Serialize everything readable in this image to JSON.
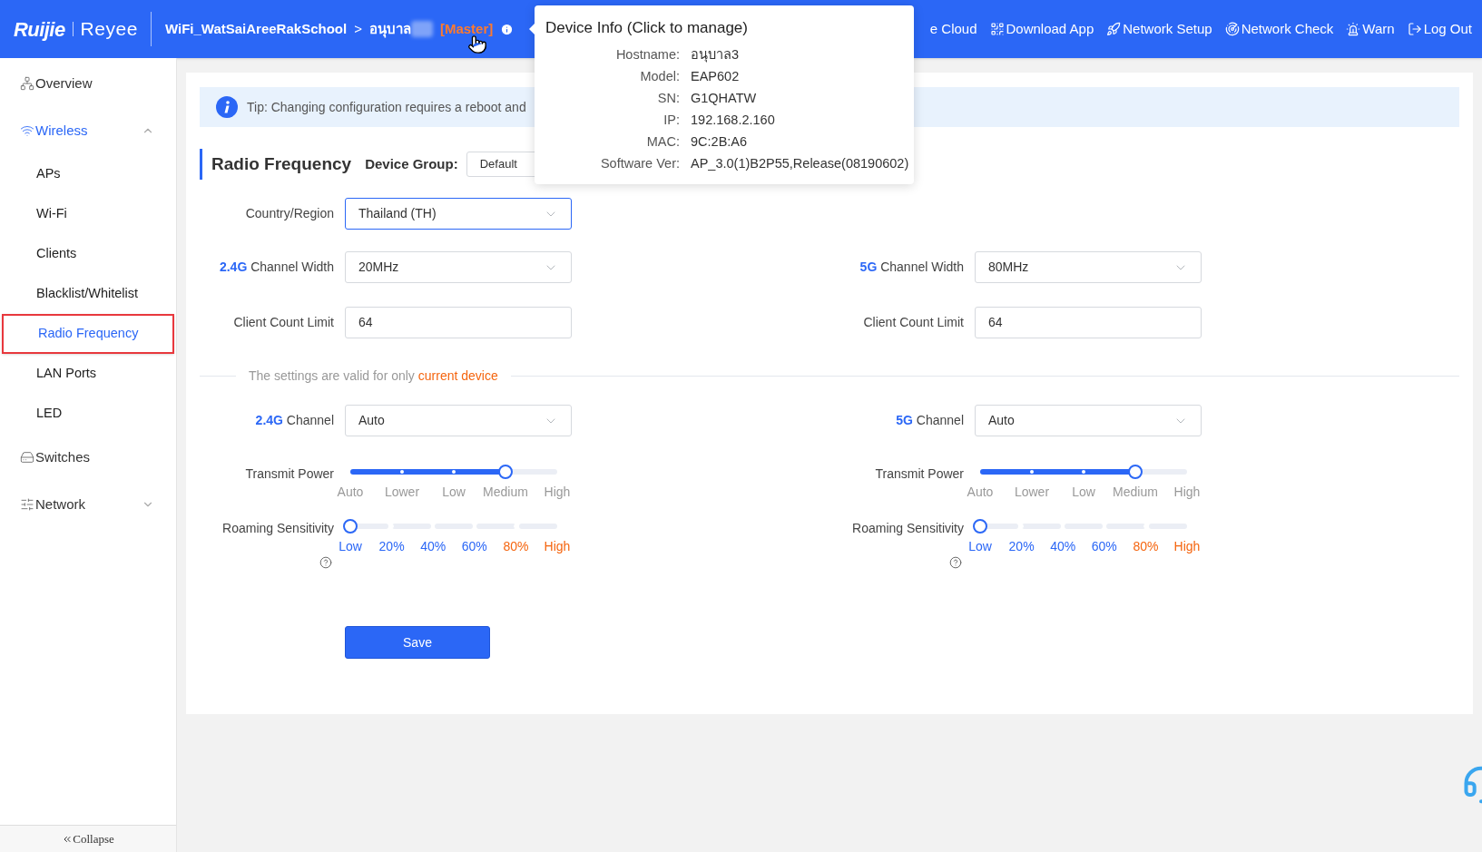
{
  "header": {
    "logo": {
      "brand": "Ruijie",
      "product": "Reyee"
    },
    "breadcrumb": {
      "network": "WiFi_WatSaiAreeRakSchool",
      "separator": ">",
      "device": "อนุบาล",
      "role": "[Master]"
    },
    "nav": [
      {
        "label": "e Cloud"
      },
      {
        "label": "Download App"
      },
      {
        "label": "Network Setup"
      },
      {
        "label": "Network Check"
      },
      {
        "label": "Warn"
      },
      {
        "label": "Log Out"
      }
    ]
  },
  "device_popover": {
    "title": "Device Info (Click to manage)",
    "rows": [
      {
        "label": "Hostname:",
        "value": "อนุบาล3"
      },
      {
        "label": "Model:",
        "value": "EAP602"
      },
      {
        "label": "SN:",
        "value": "G1QHATW"
      },
      {
        "label": "IP:",
        "value": "192.168.2.160"
      },
      {
        "label": "MAC:",
        "value": "9C:2B:A6"
      },
      {
        "label": "Software Ver:",
        "value": "AP_3.0(1)B2P55,Release(08190602)"
      }
    ]
  },
  "sidebar": {
    "items": [
      {
        "label": "Overview",
        "selected": false
      },
      {
        "label": "Wireless",
        "selected": true,
        "expanded": true,
        "children": [
          {
            "label": "APs",
            "selected": false
          },
          {
            "label": "Wi-Fi",
            "selected": false
          },
          {
            "label": "Clients",
            "selected": false
          },
          {
            "label": "Blacklist/Whitelist",
            "selected": false
          },
          {
            "label": "Radio Frequency",
            "selected": true
          },
          {
            "label": "LAN Ports",
            "selected": false
          },
          {
            "label": "LED",
            "selected": false
          }
        ]
      },
      {
        "label": "Switches",
        "selected": false
      },
      {
        "label": "Network",
        "selected": false,
        "expanded": false
      }
    ],
    "collapse": "Collapse"
  },
  "tip": "Tip: Changing configuration requires a reboot and",
  "section": {
    "title": "Radio Frequency",
    "device_group": {
      "label": "Device Group:",
      "value": "Default"
    }
  },
  "country": {
    "label": "Country/Region",
    "value": "Thailand (TH)",
    "focused": true
  },
  "settings_note": {
    "text": "The settings are valid for only ",
    "highlight": "current device"
  },
  "bands": [
    {
      "channel_width": {
        "band": "2.4G",
        "label": "Channel Width",
        "value": "20MHz"
      },
      "client_limit": {
        "label": "Client Count Limit",
        "value": "64"
      },
      "channel": {
        "band": "2.4G",
        "label": "Channel",
        "value": "Auto"
      },
      "transmit_power": {
        "label": "Transmit Power",
        "level": 0.75,
        "ticks": [
          "Auto",
          "Lower",
          "Low",
          "Medium",
          "High"
        ]
      },
      "roaming": {
        "label": "Roaming Sensitivity",
        "level": 0,
        "ticks": [
          {
            "label": "Low",
            "color": "#2b67f6"
          },
          {
            "label": "20%",
            "color": "#2b67f6"
          },
          {
            "label": "40%",
            "color": "#2b67f6"
          },
          {
            "label": "60%",
            "color": "#2b67f6"
          },
          {
            "label": "80%",
            "color": "#f5650f"
          },
          {
            "label": "High",
            "color": "#f5650f"
          }
        ]
      }
    },
    {
      "channel_width": {
        "band": "5G",
        "label": "Channel Width",
        "value": "80MHz"
      },
      "client_limit": {
        "label": "Client Count Limit",
        "value": "64"
      },
      "channel": {
        "band": "5G",
        "label": "Channel",
        "value": "Auto"
      },
      "transmit_power": {
        "label": "Transmit Power",
        "level": 0.75,
        "ticks": [
          "Auto",
          "Lower",
          "Low",
          "Medium",
          "High"
        ]
      },
      "roaming": {
        "label": "Roaming Sensitivity",
        "level": 0,
        "ticks": [
          {
            "label": "Low",
            "color": "#2b67f6"
          },
          {
            "label": "20%",
            "color": "#2b67f6"
          },
          {
            "label": "40%",
            "color": "#2b67f6"
          },
          {
            "label": "60%",
            "color": "#2b67f6"
          },
          {
            "label": "80%",
            "color": "#f5650f"
          },
          {
            "label": "High",
            "color": "#f5650f"
          }
        ]
      }
    }
  ],
  "save": "Save"
}
